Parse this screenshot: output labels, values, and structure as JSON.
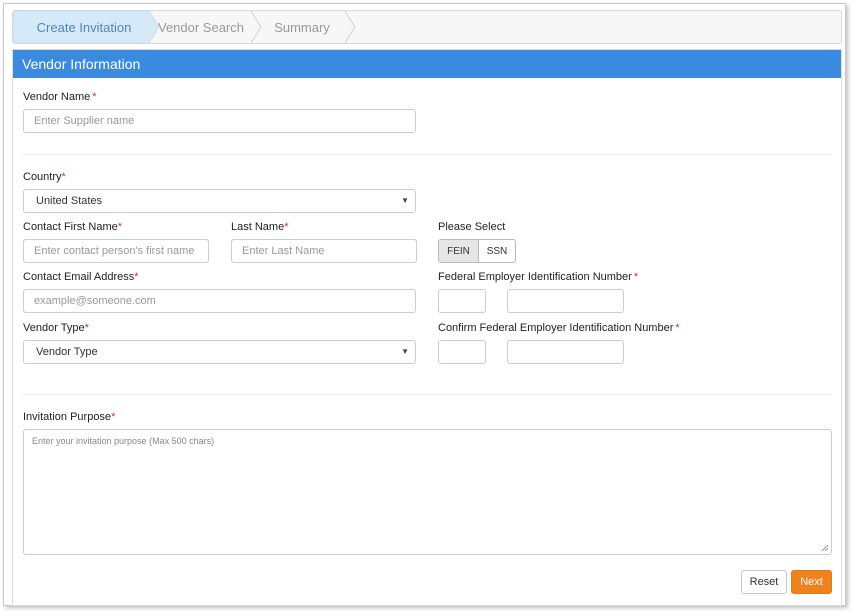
{
  "wizard": {
    "steps": [
      {
        "label": "Create Invitation"
      },
      {
        "label": "Vendor Search"
      },
      {
        "label": "Summary"
      }
    ]
  },
  "panel": {
    "title": "Vendor Information"
  },
  "form": {
    "vendor_name": {
      "label": "Vendor Name",
      "placeholder": "Enter Supplier name"
    },
    "country": {
      "label": "Country",
      "value": "United States"
    },
    "first_name": {
      "label": "Contact First Name",
      "placeholder": "Enter contact person's first name"
    },
    "last_name": {
      "label": "Last Name",
      "placeholder": "Enter Last Name"
    },
    "please_select": {
      "label": "Please Select",
      "options": [
        "FEIN",
        "SSN"
      ],
      "selected": "FEIN"
    },
    "email": {
      "label": "Contact Email Address",
      "placeholder": "example@someone.com"
    },
    "fein": {
      "label": "Federal Employer Identification Number"
    },
    "vendor_type": {
      "label": "Vendor Type",
      "value": "Vendor Type"
    },
    "confirm_fein": {
      "label": "Confirm Federal Employer Identification Number"
    },
    "purpose": {
      "label": "Invitation Purpose",
      "placeholder": "Enter your invitation purpose (Max 500 chars)"
    },
    "required_marker": "*"
  },
  "actions": {
    "reset": "Reset",
    "next": "Next"
  },
  "colors": {
    "header": "#3a8be0",
    "next_button": "#f0821e",
    "required": "#c0392b",
    "active_step_bg": "#d6e9f8"
  }
}
